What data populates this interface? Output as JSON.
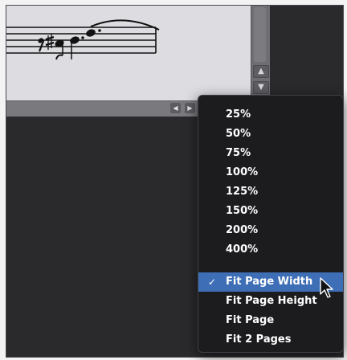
{
  "zoom_menu": {
    "percent_items": [
      "25%",
      "50%",
      "75%",
      "100%",
      "125%",
      "150%",
      "200%",
      "400%"
    ],
    "fit_items": [
      "Fit Page Width",
      "Fit Page Height",
      "Fit Page",
      "Fit 2 Pages"
    ],
    "selected": "Fit Page Width",
    "checkmark": "✓"
  },
  "scroll": {
    "up_arrow": "▲",
    "down_arrow": "▼",
    "left_arrow": "◀",
    "right_arrow": "▶"
  },
  "colors": {
    "selection": "#3e6fb6",
    "menu_background": "#1c1c1f",
    "score_background": "#dddde1"
  },
  "icons": {
    "cursor": "mouse-pointer-icon",
    "check": "checkmark-icon"
  }
}
